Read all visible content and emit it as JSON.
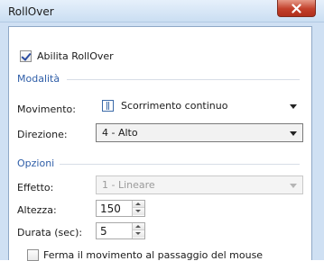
{
  "window": {
    "title": "RollOver",
    "close_icon": "close-icon"
  },
  "enable_checkbox": {
    "label": "Abilita RollOver",
    "checked": true
  },
  "group_mode": {
    "label": "Modalità"
  },
  "movement": {
    "label": "Movimento:",
    "value": "Scorrimento continuo",
    "icon": "scroll-icon"
  },
  "direction": {
    "label": "Direzione:",
    "value": "4 - Alto"
  },
  "group_options": {
    "label": "Opzioni"
  },
  "effect": {
    "label": "Effetto:",
    "value": "1 - Lineare",
    "disabled": true
  },
  "height": {
    "label": "Altezza:",
    "value": "150"
  },
  "duration": {
    "label": "Durata (sec):",
    "value": "5"
  },
  "pause_checkbox": {
    "label": "Ferma il movimento al passaggio del mouse",
    "checked": false
  },
  "colors": {
    "group_label": "#2f5ea8",
    "close_button": "#c2402b",
    "frame": "#cfe0f3"
  }
}
